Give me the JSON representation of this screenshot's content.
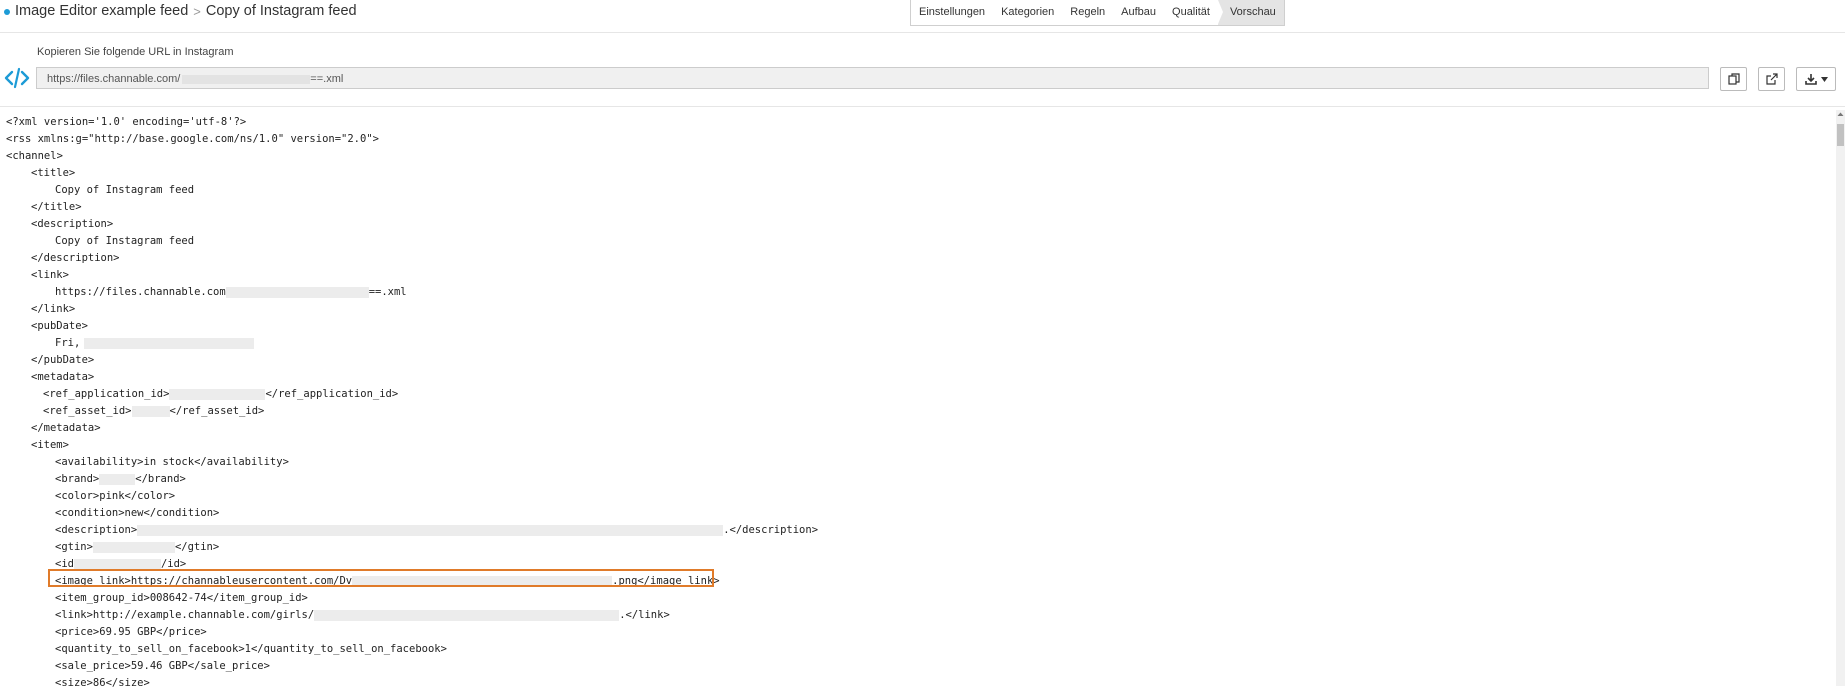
{
  "header": {
    "crumb1": "Image Editor example feed",
    "crumb_sep": ">",
    "crumb2": "Copy of Instagram feed",
    "steps": [
      "Einstellungen",
      "Kategorien",
      "Regeln",
      "Aufbau",
      "Qualität",
      "Vorschau"
    ]
  },
  "url_section": {
    "label": "Kopieren Sie folgende URL in Instagram",
    "url_start": "https://files.channable.com/",
    "url_end": "==.xml",
    "icon": "code-icon",
    "buttons": [
      "copy-icon",
      "external-link-icon",
      "download-icon"
    ]
  },
  "colors": {
    "accent": "#1d9bd6",
    "highlight": "#e07b2a"
  },
  "xml": {
    "l0": "<?xml version='1.0' encoding='utf-8'?>",
    "l1": "<rss xmlns:g=\"http://base.google.com/ns/1.0\" version=\"2.0\">",
    "l2": "<channel>",
    "l3": "<title>",
    "l4": "Copy of Instagram feed",
    "l5": "</title>",
    "l6": "<description>",
    "l7": "Copy of Instagram feed",
    "l8": "</description>",
    "l9": "<link>",
    "l10a": "https://files.channable.com",
    "l10b": "==.xml",
    "l11": "</link>",
    "l12": "<pubDate>",
    "l13": "Fri,",
    "l14": "</pubDate>",
    "l15": "<metadata>",
    "l16a": "<ref_application_id>",
    "l16b": "</ref_application_id>",
    "l17a": "<ref_asset_id>",
    "l17b": "</ref_asset_id>",
    "l18": "</metadata>",
    "l19": "<item>",
    "l20": "<availability>in stock</availability>",
    "l21a": "<brand>",
    "l21b": "</brand>",
    "l22": "<color>pink</color>",
    "l23": "<condition>new</condition>",
    "l24a": "<description>",
    "l24b": ".</description>",
    "l25a": "<gtin>",
    "l25b": "</gtin>",
    "l26a": "<id",
    "l26b": "/id>",
    "l27a": "<image_link>https://channableusercontent.com/Dv",
    "l27b": ".png</image_link>",
    "l28": "<item_group_id>008642-74</item_group_id>",
    "l29a": "<link>http://example.channable.com/girls/",
    "l29b": ".</link>",
    "l30": "<price>69.95 GBP</price>",
    "l31": "<quantity_to_sell_on_facebook>1</quantity_to_sell_on_facebook>",
    "l32": "<sale_price>59.46 GBP</sale_price>",
    "l33": "<size>86</size>"
  }
}
